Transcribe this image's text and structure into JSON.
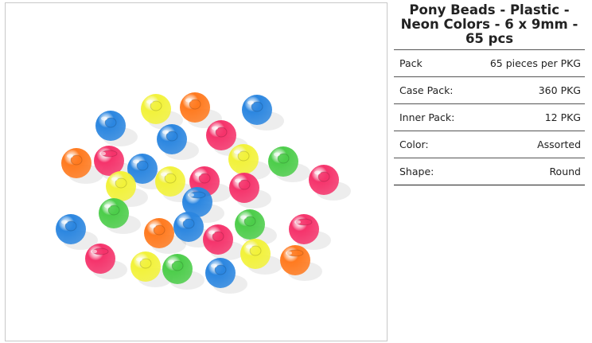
{
  "product": {
    "title": "Pony Beads - Plastic - Neon Colors - 6 x 9mm - 65 pcs",
    "image_subject": "neon pony beads",
    "colors": {
      "blue": "#2b86e0",
      "yellow": "#f2f23a",
      "orange": "#ff7a1f",
      "pink": "#f5336b",
      "green": "#4ccd4a"
    },
    "specs": [
      {
        "label": "Pack",
        "value": "65 pieces per PKG"
      },
      {
        "label": "Case Pack:",
        "value": "360 PKG"
      },
      {
        "label": "Inner Pack:",
        "value": "12 PKG"
      },
      {
        "label": "Color:",
        "value": "Assorted"
      },
      {
        "label": "Shape:",
        "value": "Round"
      }
    ]
  }
}
